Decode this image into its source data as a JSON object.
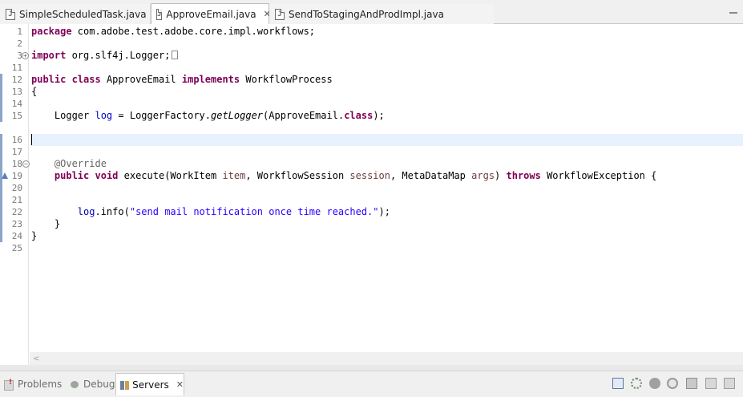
{
  "editor_tabs": [
    {
      "label": "SimpleScheduledTask.java",
      "icon": "java-file-icon",
      "active": false
    },
    {
      "label": "ApproveEmail.java",
      "icon": "java-file-icon",
      "active": true,
      "close": "✕"
    },
    {
      "label": "SendToStagingAndProdImpl.java",
      "icon": "java-file-icon",
      "active": false
    }
  ],
  "code": {
    "line_numbers": [
      "1",
      "2",
      "3",
      "11",
      "12",
      "13",
      "14",
      "15",
      "16",
      "17",
      "18",
      "19",
      "20",
      "21",
      "22",
      "23",
      "24",
      "25"
    ],
    "l1": {
      "kw": "package",
      "rest": " com.adobe.test.adobe.core.impl.workflows;"
    },
    "l3": {
      "kw": "import",
      "rest": " org.slf4j.Logger;"
    },
    "l12": {
      "kw1": "public",
      "kw2": "class",
      "name": " ApproveEmail ",
      "kw3": "implements",
      "rest": " WorkflowProcess"
    },
    "l13": "{",
    "l15": {
      "pre": "    Logger ",
      "field": "log",
      "mid": " = LoggerFactory.",
      "call": "getLogger",
      "post": "(ApproveEmail.",
      "kw": "class",
      "end": ");"
    },
    "l18": "    @Override",
    "l19": {
      "kw1": "public",
      "kw2": "void",
      "sig1": " execute(WorkItem ",
      "p1": "item",
      "sig2": ", WorkflowSession ",
      "p2": "session",
      "sig3": ", MetaDataMap ",
      "p3": "args",
      "sig4": ") ",
      "kw3": "throws",
      "sig5": " WorkflowException {"
    },
    "l22": {
      "field": "log",
      "call": ".info(",
      "str": "\"send mail notification once time reached.\"",
      "end": ");"
    },
    "l23": "    }",
    "l24": "}"
  },
  "bottom_panel": {
    "tabs": [
      {
        "label": "Problems",
        "icon": "problems-icon"
      },
      {
        "label": "Debug",
        "icon": "debug-icon"
      },
      {
        "label": "Servers",
        "icon": "servers-icon",
        "active": true,
        "close": "✕"
      }
    ],
    "toolbar_icons": [
      "collapse-all-icon",
      "debug-server-icon",
      "start-server-icon",
      "profile-server-icon",
      "stop-server-icon",
      "publish-icon",
      "clean-icon"
    ]
  },
  "colors": {
    "keyword": "#7f0055",
    "field": "#0000c0",
    "string": "#2a00ff",
    "annotation": "#646464",
    "current_line": "#e8f2fe"
  }
}
